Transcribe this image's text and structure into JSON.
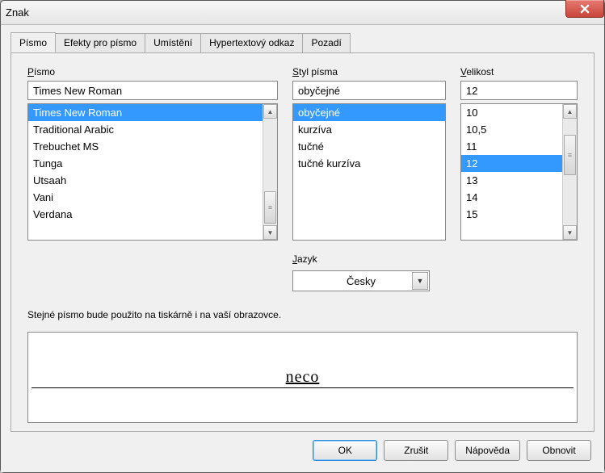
{
  "window": {
    "title": "Znak"
  },
  "tabs": [
    {
      "label": "Písmo",
      "active": true
    },
    {
      "label": "Efekty pro písmo",
      "active": false
    },
    {
      "label": "Umístění",
      "active": false
    },
    {
      "label": "Hypertextový odkaz",
      "active": false
    },
    {
      "label": "Pozadí",
      "active": false
    }
  ],
  "font": {
    "label": "Písmo",
    "value": "Times New Roman",
    "items": [
      "Times New Roman",
      "Traditional Arabic",
      "Trebuchet MS",
      "Tunga",
      "Utsaah",
      "Vani",
      "Verdana"
    ],
    "selected_index": 0
  },
  "style": {
    "label": "Styl písma",
    "value": "obyčejné",
    "items": [
      "obyčejné",
      "kurzíva",
      "tučné",
      "tučné kurzíva"
    ],
    "selected_index": 0
  },
  "size": {
    "label": "Velikost",
    "value": "12",
    "items": [
      "10",
      "10,5",
      "11",
      "12",
      "13",
      "14",
      "15"
    ],
    "selected_index": 3
  },
  "language": {
    "label": "Jazyk",
    "value": "Česky"
  },
  "info": "Stejné písmo bude použito na tiskárně i na vaší obrazovce.",
  "preview_text": "neco",
  "buttons": {
    "ok": "OK",
    "cancel": "Zrušit",
    "help": "Nápověda",
    "reset": "Obnovit"
  }
}
